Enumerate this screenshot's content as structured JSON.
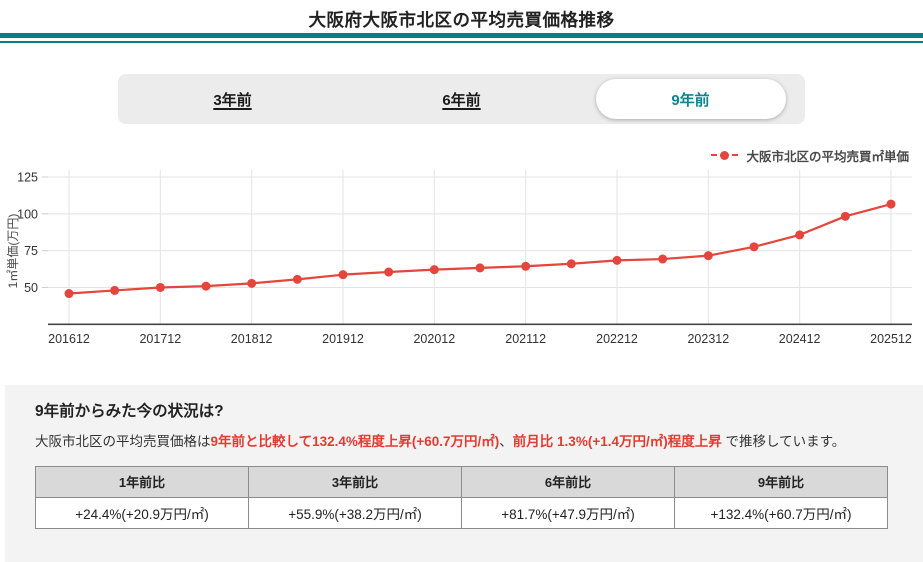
{
  "page": {
    "title": "大阪府大阪市北区の平均売買価格推移"
  },
  "colors": {
    "accent_teal": "#0c7d87",
    "tab_selected_text": "#0e8491",
    "line_red": "#e4453c",
    "text_red": "#e23b30",
    "grid": "#e3e3e3",
    "axis": "#444444",
    "tick_text": "#333333",
    "panel_bg": "#f3f3f3",
    "table_header_bg": "#d9d9d9"
  },
  "tabs": [
    {
      "label": "3年前",
      "selected": false
    },
    {
      "label": "6年前",
      "selected": false
    },
    {
      "label": "9年前",
      "selected": true
    }
  ],
  "legend": {
    "label": "大阪市北区の平均売買㎡単価"
  },
  "chart_data": {
    "type": "line",
    "ylabel": "1㎡単価(万円)",
    "categories": [
      "201612",
      "201706",
      "201712",
      "201806",
      "201812",
      "201906",
      "201912",
      "202006",
      "202012",
      "202106",
      "202112",
      "202206",
      "202212",
      "202306",
      "202312",
      "202406",
      "202412",
      "202506",
      "202512"
    ],
    "series": [
      {
        "name": "大阪市北区の平均売買㎡単価",
        "values": [
          45.9,
          48.0,
          50.0,
          50.9,
          52.8,
          55.5,
          58.7,
          60.5,
          62.1,
          63.3,
          64.4,
          66.1,
          68.4,
          69.3,
          71.6,
          77.6,
          85.7,
          98.3,
          106.6
        ]
      }
    ],
    "x_tick_labels": [
      "201612",
      "201712",
      "201812",
      "201912",
      "202012",
      "202112",
      "202212",
      "202312",
      "202412",
      "202512"
    ],
    "yticks": [
      50,
      75,
      100,
      125
    ],
    "ylim": [
      25,
      125
    ],
    "grid": true,
    "legend_position": "top-right"
  },
  "summary": {
    "heading": "9年前からみた今の状況は?",
    "text_prefix": "大阪市北区の平均売買価格は",
    "highlight1": "9年前と比較して132.4%程度上昇(+60.7万円/㎡)",
    "separator": "、",
    "highlight2": "前月比 1.3%(+1.4万円/㎡)程度上昇",
    "text_suffix": " で推移しています。"
  },
  "comparison_table": {
    "headers": [
      "1年前比",
      "3年前比",
      "6年前比",
      "9年前比"
    ],
    "values": [
      "+24.4%(+20.9万円/㎡)",
      "+55.9%(+38.2万円/㎡)",
      "+81.7%(+47.9万円/㎡)",
      "+132.4%(+60.7万円/㎡)"
    ]
  }
}
